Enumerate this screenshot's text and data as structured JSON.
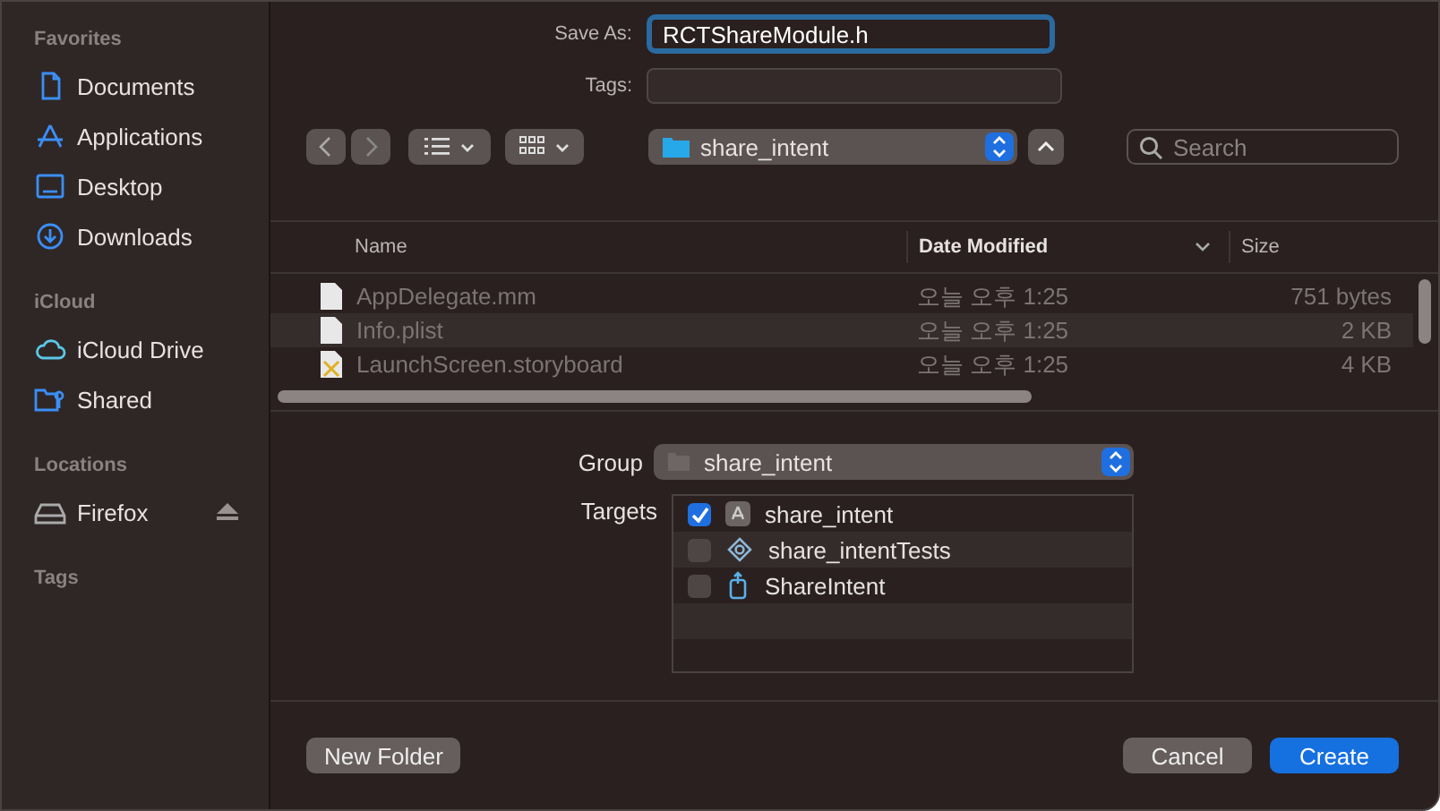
{
  "sidebar": {
    "sections": [
      {
        "title": "Favorites",
        "items": [
          {
            "label": "Documents",
            "kind": "document",
            "ejectable": false
          },
          {
            "label": "Applications",
            "kind": "apps",
            "ejectable": false
          },
          {
            "label": "Desktop",
            "kind": "desktop",
            "ejectable": false
          },
          {
            "label": "Downloads",
            "kind": "download",
            "ejectable": false
          }
        ]
      },
      {
        "title": "iCloud",
        "items": [
          {
            "label": "iCloud Drive",
            "kind": "cloud",
            "ejectable": false
          },
          {
            "label": "Shared",
            "kind": "shared",
            "ejectable": false
          }
        ]
      },
      {
        "title": "Locations",
        "items": [
          {
            "label": "Firefox",
            "kind": "drive",
            "ejectable": true
          }
        ]
      },
      {
        "title": "Tags"
      }
    ]
  },
  "save_as": {
    "label": "Save As:",
    "value": "RCTShareModule.h"
  },
  "tags": {
    "label": "Tags:"
  },
  "toolbar": {
    "location": "share_intent",
    "search": {
      "placeholder": "Search"
    }
  },
  "file_list": {
    "columns": [
      {
        "label": "Name",
        "sorted": false
      },
      {
        "label": "Date Modified",
        "sorted": true
      },
      {
        "label": "Size",
        "sorted": false
      }
    ],
    "rows": [
      {
        "name": "AppDelegate.mm",
        "date": "오늘 오후 1:25",
        "size": "751 bytes",
        "kind": "source",
        "disabled": true
      },
      {
        "name": "Info.plist",
        "date": "오늘 오후 1:25",
        "size": "2 KB",
        "kind": "source",
        "disabled": true
      },
      {
        "name": "LaunchScreen.storyboard",
        "date": "오늘 오후 1:25",
        "size": "4 KB",
        "kind": "storyboard",
        "disabled": true
      }
    ]
  },
  "group": {
    "label": "Group",
    "value": "share_intent"
  },
  "targets": {
    "label": "Targets",
    "items": [
      {
        "label": "share_intent",
        "kind": "app",
        "checked": true
      },
      {
        "label": "share_intentTests",
        "kind": "tests",
        "checked": false
      },
      {
        "label": "ShareIntent",
        "kind": "extension",
        "checked": false
      }
    ]
  },
  "buttons": {
    "new_folder": "New Folder",
    "cancel": "Cancel",
    "create": "Create"
  }
}
